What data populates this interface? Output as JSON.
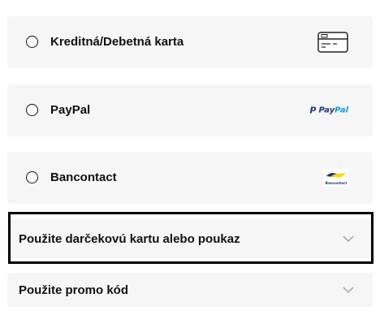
{
  "payment_options": [
    {
      "label": "Kreditná/Debetná karta",
      "icon": "credit-card-icon"
    },
    {
      "label": "PayPal",
      "icon": "paypal-logo",
      "logo_text_1": "Pay",
      "logo_text_2": "Pal",
      "logo_letter": "P"
    },
    {
      "label": "Bancontact",
      "icon": "bancontact-logo",
      "logo_text": "Bancontact"
    }
  ],
  "gift_card": {
    "label": "Použite darčekovú kartu alebo poukaz",
    "icon": "chevron-down-icon"
  },
  "promo_code": {
    "label": "Použite promo kód",
    "icon": "chevron-down-icon"
  },
  "colors": {
    "panel": "#f6f6f6",
    "text": "#111111",
    "paypal_dark": "#253b80",
    "paypal_light": "#179bd7",
    "bancontact_blue": "#1e3764",
    "bancontact_yellow": "#ffd800"
  }
}
